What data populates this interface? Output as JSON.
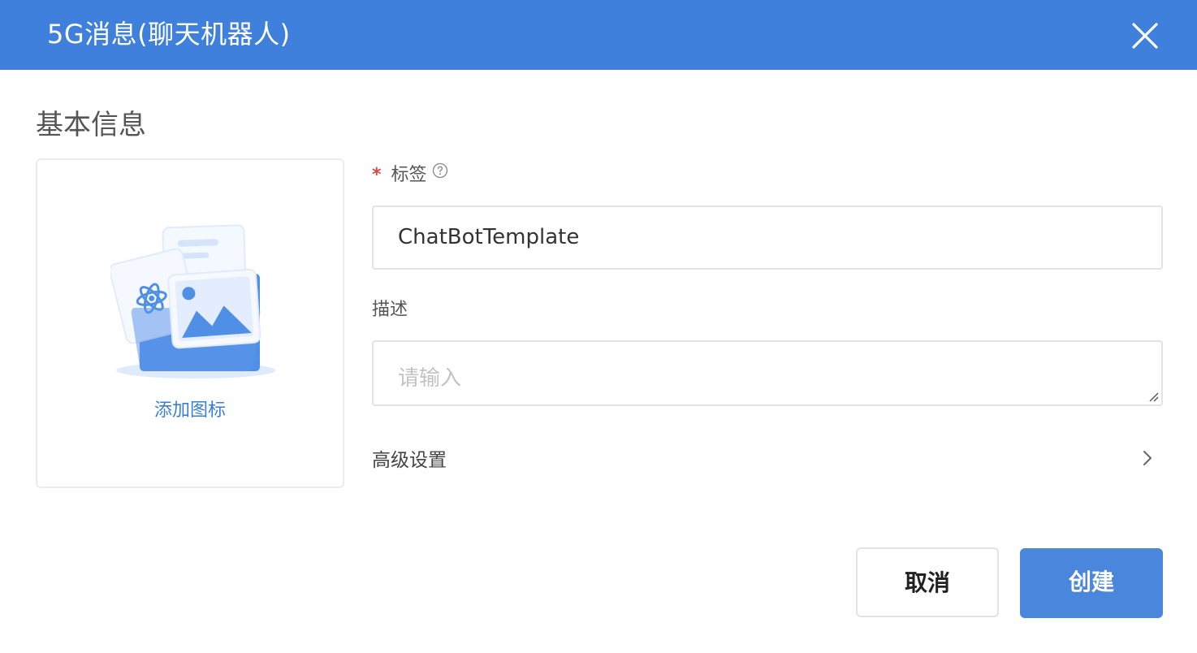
{
  "dialog": {
    "title": "5G消息(聊天机器人)",
    "close_icon": "close-icon"
  },
  "section": {
    "title": "基本信息"
  },
  "icon_upload": {
    "label": "添加图标",
    "illustration": "image-folder-icon"
  },
  "form": {
    "label_field": {
      "required_mark": "*",
      "label": "标签",
      "help_icon": "question-circle-icon",
      "value": "ChatBotTemplate"
    },
    "description_field": {
      "label": "描述",
      "placeholder": "请输入",
      "value": ""
    },
    "advanced": {
      "label": "高级设置",
      "icon": "chevron-right-icon"
    }
  },
  "buttons": {
    "cancel": "取消",
    "create": "创建"
  },
  "colors": {
    "header": "#3f80dd",
    "primary_button": "#4a86db",
    "link": "#3a7fd5",
    "required": "#e0463f"
  }
}
